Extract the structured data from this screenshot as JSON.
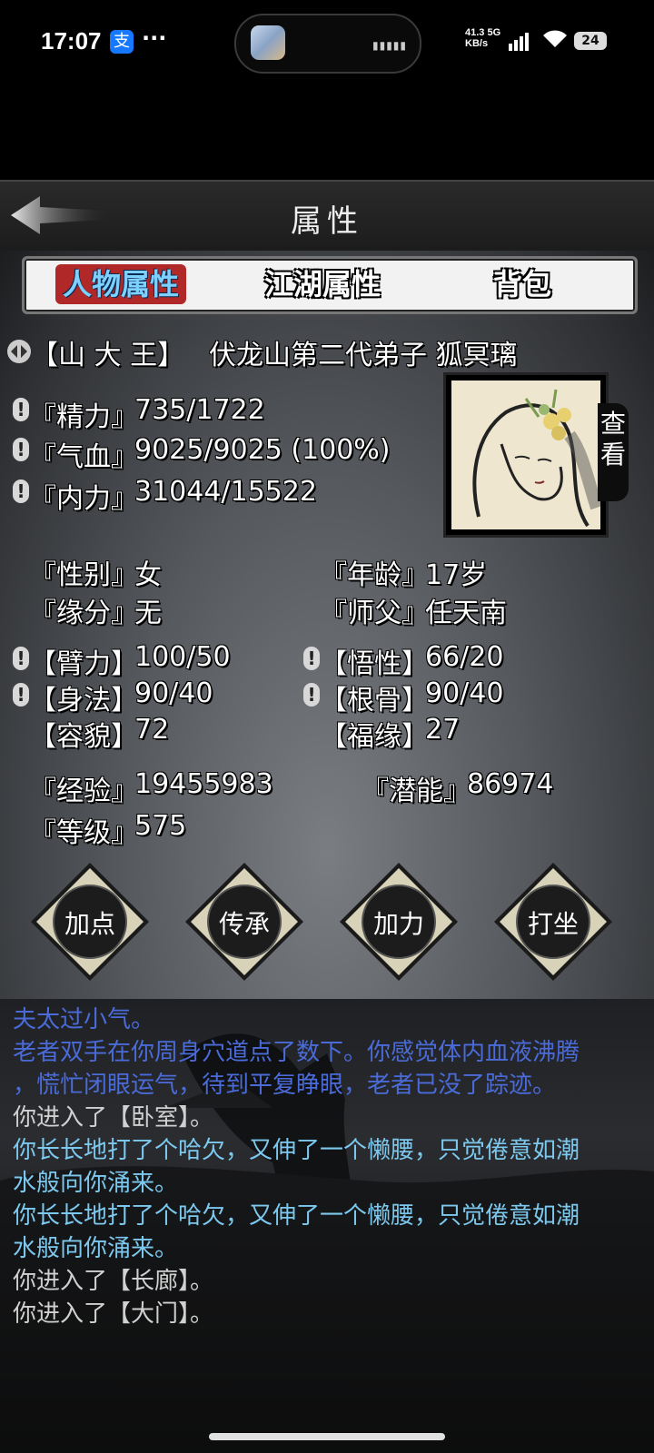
{
  "status_bar": {
    "time": "17:07",
    "alipay_icon_text": "支",
    "more": "···",
    "network_speed": "41.3",
    "network_unit": "KB/s",
    "network_type": "5G",
    "battery": "24"
  },
  "header": {
    "title": "属性"
  },
  "tabs": [
    {
      "label": "人物属性",
      "active": true
    },
    {
      "label": "江湖属性",
      "active": false
    },
    {
      "label": "背包",
      "active": false
    }
  ],
  "profile": {
    "rank": "【山 大 王】",
    "title_name": "伏龙山第二代弟子 狐冥璃",
    "view_button": "查看"
  },
  "vitals": [
    {
      "label": "『精力』",
      "value": "735/1722"
    },
    {
      "label": "『气血』",
      "value": "9025/9025 (100%)"
    },
    {
      "label": "『内力』",
      "value": "31044/15522"
    }
  ],
  "info": {
    "gender_label": "『性别』",
    "gender": "女",
    "age_label": "『年龄』",
    "age": "17岁",
    "fate_label": "『缘分』",
    "fate": "无",
    "master_label": "『师父』",
    "master": "任天南"
  },
  "attributes": {
    "strength_label": "【臂力】",
    "strength": "100/50",
    "insight_label": "【悟性】",
    "insight": "66/20",
    "agility_label": "【身法】",
    "agility": "90/40",
    "constitution_label": "【根骨】",
    "constitution": "90/40",
    "looks_label": "【容貌】",
    "looks": "72",
    "luck_label": "【福缘】",
    "luck": "27"
  },
  "progress": {
    "exp_label": "『经验』",
    "exp": "19455983",
    "potential_label": "『潜能』",
    "potential": "86974",
    "level_label": "『等级』",
    "level": "575"
  },
  "actions": [
    "加点",
    "传承",
    "加力",
    "打坐"
  ],
  "log": [
    {
      "text": "夫太过小气。",
      "color": "#4a6bd8"
    },
    {
      "text": "老者双手在你周身穴道点了数下。你感觉体内血液沸腾",
      "color": "#4a6bd8"
    },
    {
      "text": "，慌忙闭眼运气，待到平复睁眼，老者已没了踪迹。",
      "color": "#4a6bd8"
    },
    {
      "text": "你进入了【卧室】。",
      "color": "#d0d0d0"
    },
    {
      "text": "你长长地打了个哈欠，又伸了一个懒腰，只觉倦意如潮",
      "color": "#7cc8ee"
    },
    {
      "text": "水般向你涌来。",
      "color": "#7cc8ee"
    },
    {
      "text": "你长长地打了个哈欠，又伸了一个懒腰，只觉倦意如潮",
      "color": "#7cc8ee"
    },
    {
      "text": "水般向你涌来。",
      "color": "#7cc8ee"
    },
    {
      "text": "你进入了【长廊】。",
      "color": "#d0d0d0"
    },
    {
      "text": "你进入了【大门】。",
      "color": "#d0d0d0"
    }
  ]
}
